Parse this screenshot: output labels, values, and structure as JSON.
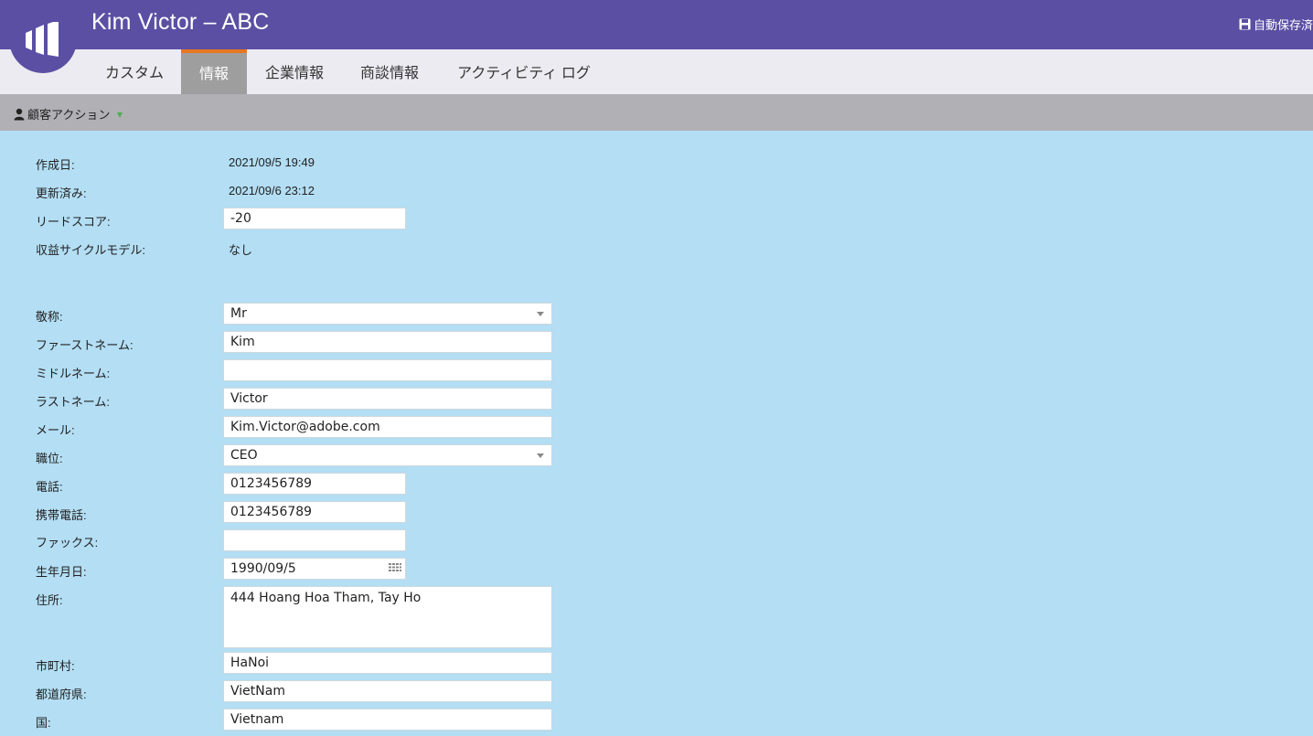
{
  "header": {
    "title": "Kim Victor – ABC",
    "autosave_label": "自動保存済"
  },
  "tabs": [
    {
      "label": "カスタム",
      "active": false
    },
    {
      "label": "情報",
      "active": true
    },
    {
      "label": "企業情報",
      "active": false
    },
    {
      "label": "商談情報",
      "active": false
    },
    {
      "label": "アクティビティ ログ",
      "active": false
    }
  ],
  "actionbar": {
    "customer_action_label": "顧客アクション"
  },
  "info": {
    "created": {
      "label": "作成日:",
      "value": "2021/09/5 19:49"
    },
    "updated": {
      "label": "更新済み:",
      "value": "2021/09/6 23:12"
    },
    "lead_score": {
      "label": "リードスコア:",
      "value": "-20"
    },
    "revenue_model": {
      "label": "収益サイクルモデル:",
      "value": "なし"
    }
  },
  "fields": {
    "salutation": {
      "label": "敬称:",
      "value": "Mr"
    },
    "first_name": {
      "label": "ファーストネーム:",
      "value": "Kim"
    },
    "middle_name": {
      "label": "ミドルネーム:",
      "value": ""
    },
    "last_name": {
      "label": "ラストネーム:",
      "value": "Victor"
    },
    "email": {
      "label": "メール:",
      "value": "Kim.Victor@adobe.com"
    },
    "job_title": {
      "label": "職位:",
      "value": "CEO"
    },
    "phone": {
      "label": "電話:",
      "value": "0123456789"
    },
    "mobile": {
      "label": "携帯電話:",
      "value": "0123456789"
    },
    "fax": {
      "label": "ファックス:",
      "value": ""
    },
    "birthday": {
      "label": "生年月日:",
      "value": "1990/09/5"
    },
    "address": {
      "label": "住所:",
      "value": "444 Hoang Hoa Tham, Tay Ho"
    },
    "city": {
      "label": "市町村:",
      "value": "HaNoi"
    },
    "state": {
      "label": "都道府県:",
      "value": "VietNam"
    },
    "country": {
      "label": "国:",
      "value": "Vietnam"
    }
  },
  "colors": {
    "header": "#5b4fa3",
    "tab_accent": "#e87722",
    "body_bg": "#b3def4"
  }
}
